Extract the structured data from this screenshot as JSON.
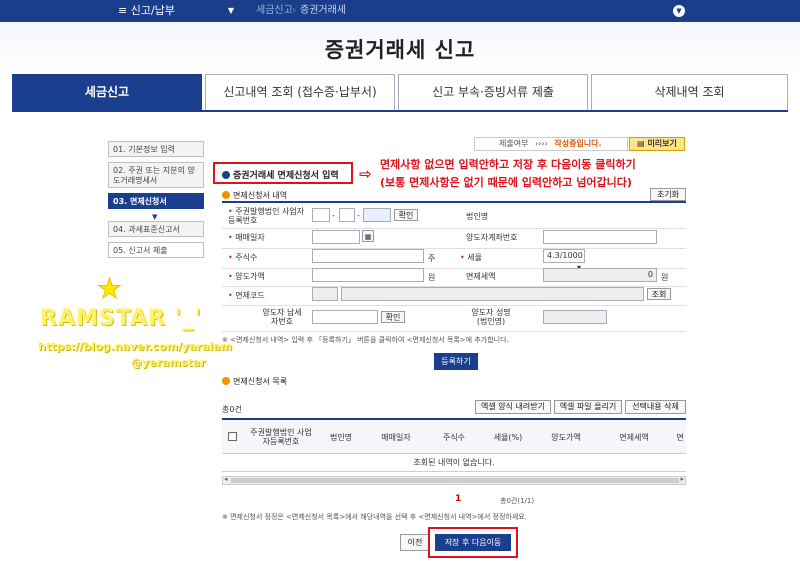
{
  "topbar": {
    "menu": "신고/납부",
    "crumbs": [
      "세금신고",
      "증권거래세"
    ]
  },
  "page_title": "증권거래세 신고",
  "tabs": [
    "세금신고",
    "신고내역 조회 (접수증·납부서)",
    "신고 부속·증빙서류 제출",
    "삭제내역 조회"
  ],
  "steps": [
    "01. 기본정보 입력",
    "02. 주권 또는 지분의 양도거래명세서",
    "03. 면제신청서",
    "04. 과세표준신고서",
    "05. 신고서 제출"
  ],
  "status": {
    "label": "제출여부",
    "arrows": "››››",
    "value": "작성중입니다."
  },
  "preview_label": "미리보기",
  "section1_title": "증권거래세 면제신청서 입력",
  "annotation": {
    "line1": "면제사항 없으면 입력안하고 저장 후 다음이동 클릭하기",
    "line2": "(보통 면제사항은 없기 때문에 입력안하고 넘어갑니다)"
  },
  "reset_label": "초기화",
  "detail_title": "면제신청서 내역",
  "form": {
    "issuer_label": "주권발행법인 사업자등록번호",
    "confirm": "확인",
    "corp_name": "법인명",
    "trade_date": "매매일자",
    "transferor_acct": "양도자계좌번호",
    "shares": "주식수",
    "shares_unit": "주",
    "tax_rate": "세율",
    "tax_rate_value": "4.3/1000",
    "transfer_price": "양도가액",
    "won": "원",
    "exempt_tax": "면제세액",
    "exempt_tax_value": "0",
    "exempt_code": "면제코드",
    "search": "조회",
    "transferor_id": "양도자 납세자번호",
    "transferor_name": "양도자 성명(법인명)"
  },
  "note1": "※ <면제신청서 내역> 입력 후 「등록하기」 버튼을 클릭하여 <면제신청서 목록>에 추가합니다.",
  "register_label": "등록하기",
  "list_title": "면제신청서 목록",
  "total": "총0건",
  "list_buttons": [
    "엑셀 양식 내려받기",
    "엑셀 파일 올리기",
    "선택내용 삭제"
  ],
  "list_headers": [
    "주권발행법인 사업자등록번호",
    "법인명",
    "매매일자",
    "주식수",
    "세율(%)",
    "양도가액",
    "면제세액",
    "면"
  ],
  "empty_text": "조회된 내역이 없습니다.",
  "pager": {
    "page": "1",
    "count": "총0건(1/1)"
  },
  "note2": "※ 면제신청서 정정은 <면제신청서 목록>에서 해당내역을 선택 후 <면제신청서 내역>에서 정정하세요.",
  "prev_label": "이전",
  "save_next_label": "저장 후 다음이동",
  "watermark": {
    "name": "RAMSTAR '_'",
    "url": "https://blog.naver.com/yaralam",
    "handle": "@yeramstar"
  },
  "colors": {
    "navy": "#1b3f8f",
    "annotation_red": "#e0121b"
  }
}
